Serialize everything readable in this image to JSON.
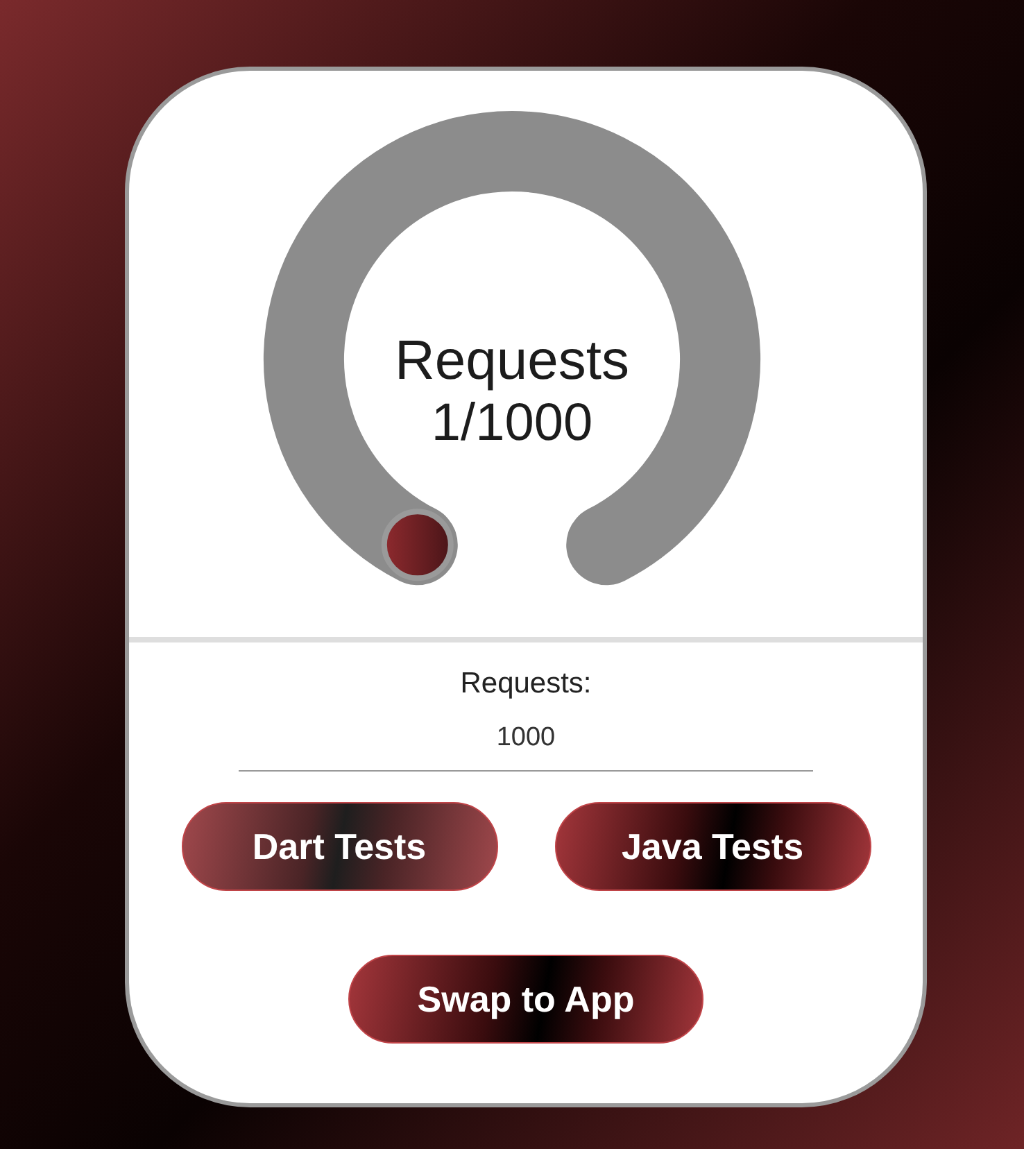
{
  "gauge": {
    "title": "Requests",
    "reading": "1/1000"
  },
  "requests_field": {
    "label": "Requests:",
    "value": "1000"
  },
  "buttons": [
    {
      "label": "Dart Tests",
      "highlighted": true
    },
    {
      "label": "Java Tests",
      "highlighted": false
    }
  ],
  "footer_button": {
    "label": "Swap to App"
  }
}
